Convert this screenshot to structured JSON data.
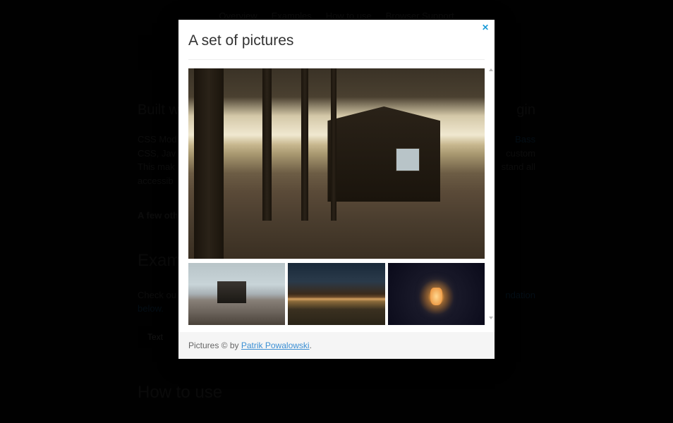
{
  "nav": {
    "items": [
      "Overview",
      "Examples",
      "How to use",
      "Browser Support"
    ]
  },
  "bg": {
    "built_title": "Built w",
    "built_suffix": "gin",
    "p1_prefix": "CSS Mod",
    "p1_link": "Bass",
    "p2_prefix": "CSS, Jav",
    "p2_suffix": "custom",
    "p3_prefix": "This mak",
    "p3_suffix": "stand all",
    "p4": "accessib",
    "few": "A few oth",
    "examples_title": "Exam",
    "check_prefix": "Check ou",
    "check_link": "ndation",
    "check_suffix": "below.",
    "btn": "Text",
    "howto_title": "How to use"
  },
  "modal": {
    "title": "A set of pictures",
    "footer_prefix": "Pictures © by ",
    "footer_link": "Patrik Powalowski",
    "footer_suffix": ".",
    "close": "✕"
  }
}
